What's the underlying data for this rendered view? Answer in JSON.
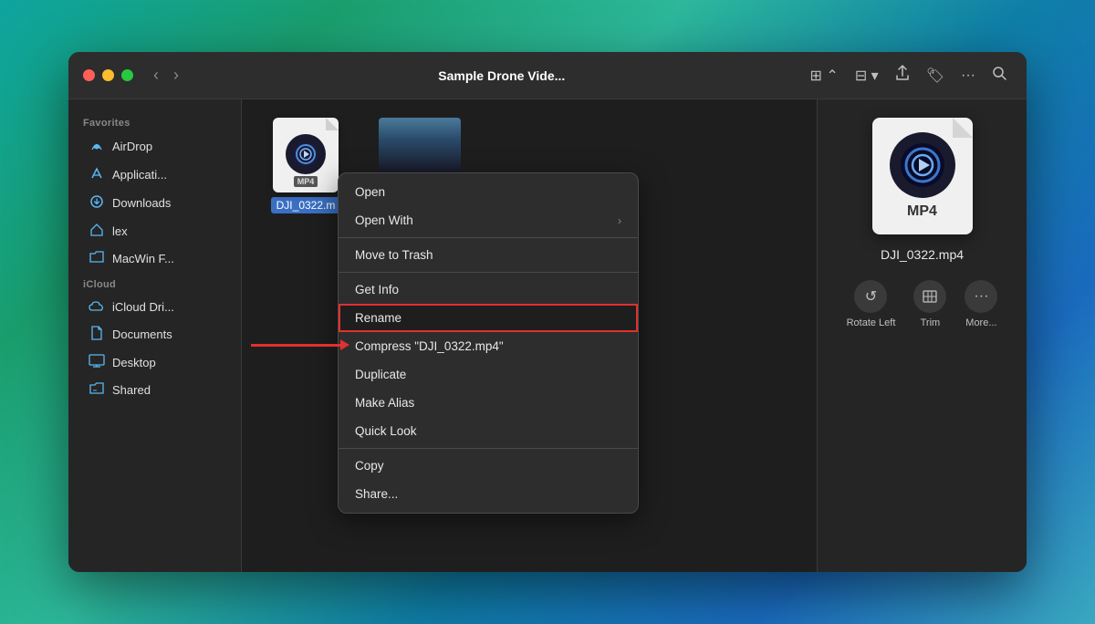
{
  "window": {
    "title": "Sample Drone Vide..."
  },
  "titlebar": {
    "back_label": "‹",
    "forward_label": "›",
    "view_grid_icon": "⊞",
    "view_options_icon": "⊟",
    "share_icon": "⬆",
    "tag_icon": "🏷",
    "more_icon": "···",
    "search_icon": "🔍"
  },
  "sidebar": {
    "favorites_header": "Favorites",
    "icloud_header": "iCloud",
    "shared_header": "Shared",
    "items": [
      {
        "id": "airdrop",
        "label": "AirDrop",
        "icon": "📡"
      },
      {
        "id": "applications",
        "label": "Applicati...",
        "icon": "🚀"
      },
      {
        "id": "downloads",
        "label": "Downloads",
        "icon": "⬇"
      },
      {
        "id": "lex",
        "label": "lex",
        "icon": "🏠"
      },
      {
        "id": "macwinf",
        "label": "MacWin F...",
        "icon": "📁"
      },
      {
        "id": "icloud",
        "label": "iCloud Dri...",
        "icon": "☁"
      },
      {
        "id": "documents",
        "label": "Documents",
        "icon": "📄"
      },
      {
        "id": "desktop",
        "label": "Desktop",
        "icon": "🖥"
      },
      {
        "id": "shared",
        "label": "Shared",
        "icon": "📁"
      }
    ]
  },
  "files": [
    {
      "id": "dji0322",
      "name": "DJI_0322.m",
      "type": "MP4",
      "selected": true
    },
    {
      "id": "dji_video2",
      "name": "",
      "type": "video"
    }
  ],
  "context_menu": {
    "items": [
      {
        "id": "open",
        "label": "Open",
        "has_arrow": false,
        "divider_after": false
      },
      {
        "id": "open_with",
        "label": "Open With",
        "has_arrow": true,
        "divider_after": true
      },
      {
        "id": "move_trash",
        "label": "Move to Trash",
        "has_arrow": false,
        "divider_after": true
      },
      {
        "id": "get_info",
        "label": "Get Info",
        "has_arrow": false,
        "divider_after": false
      },
      {
        "id": "rename",
        "label": "Rename",
        "has_arrow": false,
        "divider_after": false,
        "highlighted": true
      },
      {
        "id": "compress",
        "label": "Compress \"DJI_0322.mp4\"",
        "has_arrow": false,
        "divider_after": false
      },
      {
        "id": "duplicate",
        "label": "Duplicate",
        "has_arrow": false,
        "divider_after": false
      },
      {
        "id": "make_alias",
        "label": "Make Alias",
        "has_arrow": false,
        "divider_after": false
      },
      {
        "id": "quick_look",
        "label": "Quick Look",
        "has_arrow": false,
        "divider_after": true
      },
      {
        "id": "copy",
        "label": "Copy",
        "has_arrow": false,
        "divider_after": false
      },
      {
        "id": "share",
        "label": "Share...",
        "has_arrow": false,
        "divider_after": false
      }
    ]
  },
  "preview": {
    "filename": "DJI_0322.mp4",
    "filetype": "MP4",
    "actions": [
      {
        "id": "rotate_left",
        "label": "Rotate Left",
        "icon": "↺"
      },
      {
        "id": "trim",
        "label": "Trim",
        "icon": "✂"
      },
      {
        "id": "more",
        "label": "More...",
        "icon": "···"
      }
    ]
  }
}
